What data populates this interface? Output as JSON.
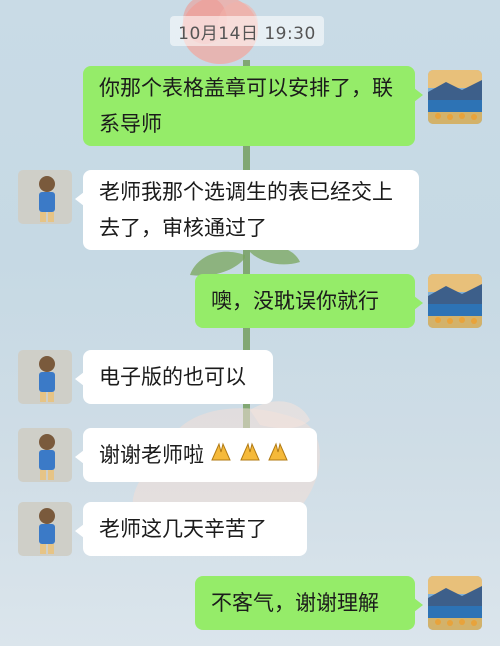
{
  "timestamp": "10月14日 19:30",
  "messages": [
    {
      "sender": "me",
      "text": "你那个表格盖章可以安排了，联系导师"
    },
    {
      "sender": "other",
      "text": "老师我那个选调生的表已经交上去了，审核通过了"
    },
    {
      "sender": "me",
      "text": "噢，没耽误你就行"
    },
    {
      "sender": "other",
      "text": "电子版的也可以"
    },
    {
      "sender": "other",
      "text": "谢谢老师啦",
      "emoji": "praying-hands-icon ×3"
    },
    {
      "sender": "other",
      "text": "老师这几天辛苦了"
    },
    {
      "sender": "me",
      "text": "不客气，谢谢理解"
    }
  ],
  "colors": {
    "me_bubble": "#95ec69",
    "other_bubble": "#ffffff"
  }
}
